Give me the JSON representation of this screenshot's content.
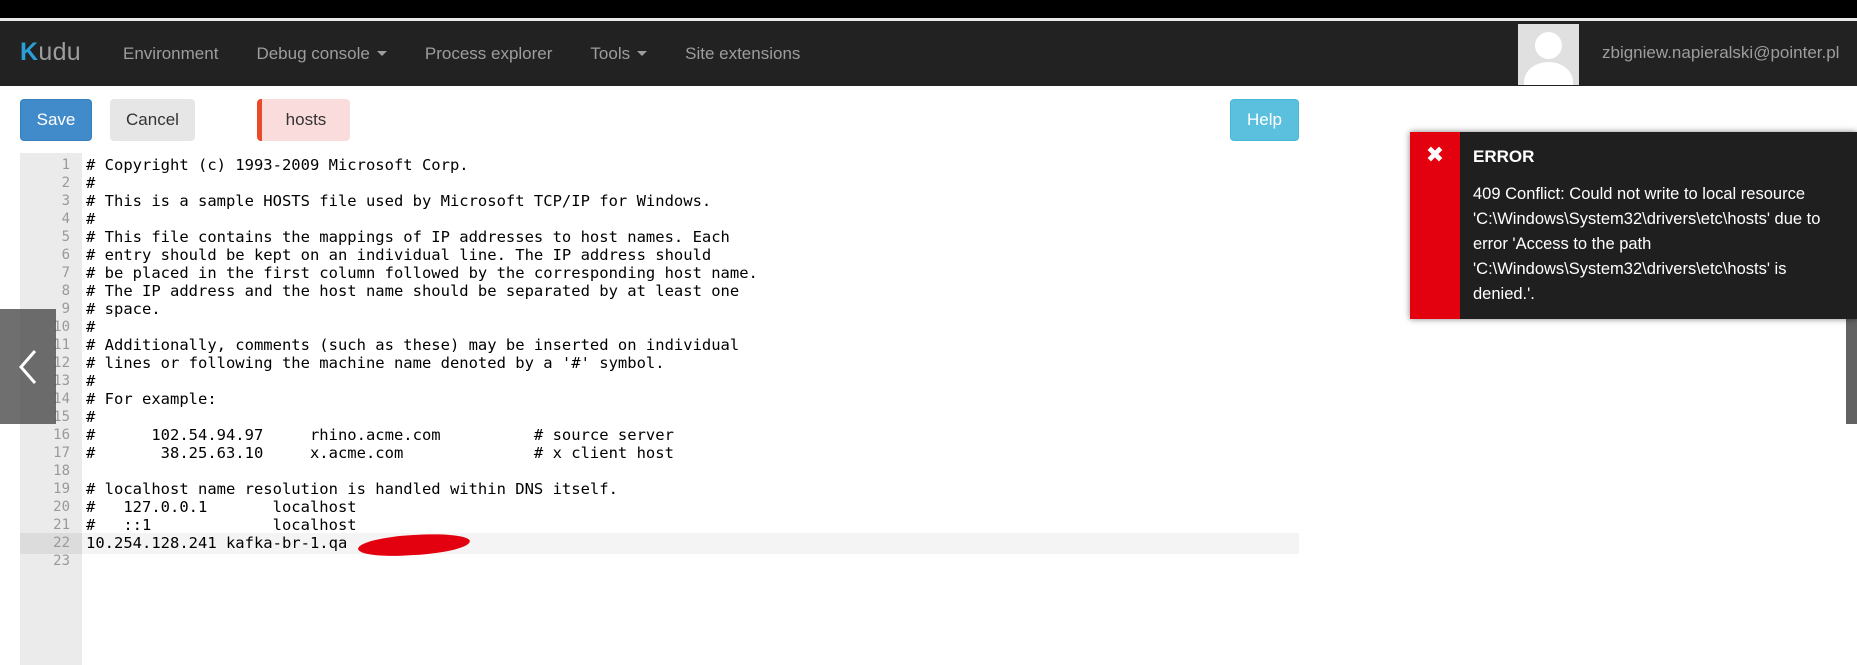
{
  "navbar": {
    "brand": "Kudu",
    "items": [
      {
        "label": "Environment",
        "dropdown": false
      },
      {
        "label": "Debug console",
        "dropdown": true
      },
      {
        "label": "Process explorer",
        "dropdown": false
      },
      {
        "label": "Tools",
        "dropdown": true
      },
      {
        "label": "Site extensions",
        "dropdown": false
      }
    ],
    "user_email": "zbigniew.napieralski@pointer.pl"
  },
  "toolbar": {
    "save_label": "Save",
    "cancel_label": "Cancel",
    "file_tab": "hosts",
    "help_label": "Help"
  },
  "editor": {
    "active_line": 22,
    "lines": [
      "# Copyright (c) 1993-2009 Microsoft Corp.",
      "#",
      "# This is a sample HOSTS file used by Microsoft TCP/IP for Windows.",
      "#",
      "# This file contains the mappings of IP addresses to host names. Each",
      "# entry should be kept on an individual line. The IP address should",
      "# be placed in the first column followed by the corresponding host name.",
      "# The IP address and the host name should be separated by at least one",
      "# space.",
      "#",
      "# Additionally, comments (such as these) may be inserted on individual",
      "# lines or following the machine name denoted by a '#' symbol.",
      "#",
      "# For example:",
      "#",
      "#      102.54.94.97     rhino.acme.com          # source server",
      "#       38.25.63.10     x.acme.com              # x client host",
      "",
      "# localhost name resolution is handled within DNS itself.",
      "#   127.0.0.1       localhost",
      "#   ::1             localhost",
      "10.254.128.241 kafka-br-1.qa",
      ""
    ]
  },
  "error_toast": {
    "title": "ERROR",
    "message": "409 Conflict: Could not write to local resource 'C:\\Windows\\System32\\drivers\\etc\\hosts' due to error 'Access to the path 'C:\\Windows\\System32\\drivers\\etc\\hosts' is denied.'."
  },
  "colors": {
    "navbar_bg": "#222222",
    "primary": "#428bca",
    "info": "#5bc0de",
    "error": "#e3000f",
    "tab_accent": "#e84a2d"
  }
}
